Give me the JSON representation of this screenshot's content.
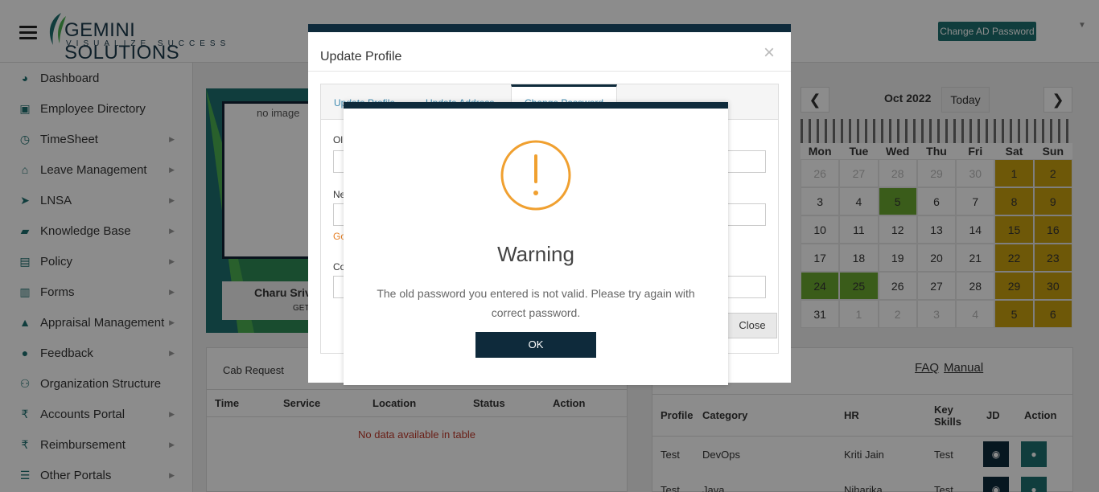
{
  "header": {
    "logo_main": "GEMINI SOLUTIONS",
    "logo_sub": "VISUALIZE SUCCESS",
    "change_ad_password": "Change AD Password"
  },
  "sidebar": {
    "items": [
      {
        "label": "Dashboard",
        "icon": "dashboard-icon",
        "arrow": false
      },
      {
        "label": "Employee Directory",
        "icon": "directory-icon",
        "arrow": false
      },
      {
        "label": "TimeSheet",
        "icon": "clock-icon",
        "arrow": true
      },
      {
        "label": "Leave Management",
        "icon": "home-icon",
        "arrow": true
      },
      {
        "label": "LNSA",
        "icon": "send-icon",
        "arrow": true
      },
      {
        "label": "Knowledge Base",
        "icon": "folder-icon",
        "arrow": true
      },
      {
        "label": "Policy",
        "icon": "document-icon",
        "arrow": true
      },
      {
        "label": "Forms",
        "icon": "forms-icon",
        "arrow": true
      },
      {
        "label": "Appraisal Management",
        "icon": "graduation-cap-icon",
        "arrow": true
      },
      {
        "label": "Feedback",
        "icon": "comments-icon",
        "arrow": true
      },
      {
        "label": "Organization Structure",
        "icon": "sitemap-icon",
        "arrow": false
      },
      {
        "label": "Accounts Portal",
        "icon": "rupee-icon",
        "arrow": true
      },
      {
        "label": "Reimbursement",
        "icon": "rupee-icon",
        "arrow": true
      },
      {
        "label": "Other Portals",
        "icon": "list-icon",
        "arrow": true
      }
    ]
  },
  "profile_card": {
    "image_alt": "no image",
    "name": "Charu Sriv",
    "subtitle": "GET"
  },
  "calendar": {
    "month": "Oct 2022",
    "today_label": "Today",
    "prev": "❮",
    "next": "❯",
    "weekdays": [
      "Mon",
      "Tue",
      "Wed",
      "Thu",
      "Fri",
      "Sat",
      "Sun"
    ],
    "weeks": [
      [
        "26",
        "27",
        "28",
        "29",
        "30",
        "1",
        "2"
      ],
      [
        "3",
        "4",
        "5",
        "6",
        "7",
        "8",
        "9"
      ],
      [
        "10",
        "11",
        "12",
        "13",
        "14",
        "15",
        "16"
      ],
      [
        "17",
        "18",
        "19",
        "20",
        "21",
        "22",
        "23"
      ],
      [
        "24",
        "25",
        "26",
        "27",
        "28",
        "29",
        "30"
      ],
      [
        "31",
        "1",
        "2",
        "3",
        "4",
        "5",
        "6"
      ]
    ]
  },
  "cab_panel": {
    "title": "Cab Request",
    "columns": [
      "Time",
      "Service",
      "Location",
      "Status",
      "Action"
    ],
    "empty_text": "No data available in table"
  },
  "jd_panel": {
    "faq": "FAQ",
    "manual": "Manual",
    "columns": [
      "Profile",
      "Category",
      "HR",
      "Key Skills",
      "JD",
      "Action"
    ],
    "rows": [
      {
        "profile": "Test",
        "category": "DevOps",
        "hr": "Kriti Jain",
        "skills": "Test"
      },
      {
        "profile": "Test",
        "category": "Java",
        "hr": "Niharika",
        "skills": "Test"
      }
    ]
  },
  "modal": {
    "title": "Update Profile",
    "close_glyph": "×",
    "tabs": [
      "Update Profile",
      "Update Address",
      "Change Password"
    ],
    "field_old": "Ol",
    "field_new": "Ne",
    "hint": "Go",
    "field_confirm": "Co",
    "close_button": "Close"
  },
  "alert": {
    "title": "Warning",
    "message": "The old password you entered is not valid. Please try again with correct password.",
    "ok_button": "OK",
    "icon": "warning-icon",
    "icon_color": "#f0a030"
  },
  "colors": {
    "navy": "#0e2a3b",
    "teal": "#1e6f6f",
    "weekend": "#c8a010",
    "green": "#6aa830"
  }
}
